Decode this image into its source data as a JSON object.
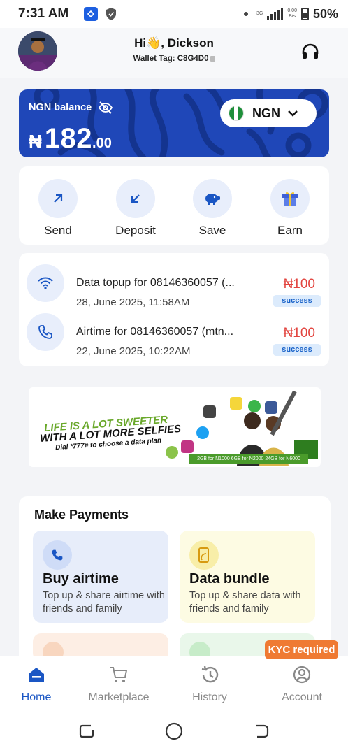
{
  "status_bar": {
    "time": "7:31 AM",
    "network_label": "3G",
    "speed": "0.00\nB/s",
    "battery": "50%"
  },
  "header": {
    "greeting": "Hi👋, Dickson",
    "wallet_tag": "Wallet Tag: C8G4D0"
  },
  "balance": {
    "label": "NGN balance",
    "currency_symbol": "₦",
    "amount_main": "182",
    "amount_decimal": ".00",
    "currency_selector": "NGN"
  },
  "actions": [
    {
      "label": "Send"
    },
    {
      "label": "Deposit"
    },
    {
      "label": "Save"
    },
    {
      "label": "Earn"
    }
  ],
  "transactions": [
    {
      "title": "Data topup for 08146360057 (...",
      "date": "28, June 2025, 11:58AM",
      "amount": "₦100",
      "status": "success"
    },
    {
      "title": "Airtime for 08146360057 (mtn...",
      "date": "22, June 2025, 10:22AM",
      "amount": "₦100",
      "status": "success"
    }
  ],
  "banner": {
    "line1": "LIFE IS A LOT SWEETER",
    "line2": "WITH A LOT MORE SELFIES",
    "line3": "Dial *777# to choose a data plan",
    "strip": "2GB for N1000   6GB for N2000   24GB for N6000"
  },
  "payments": {
    "title": "Make Payments",
    "cards": [
      {
        "title": "Buy airtime",
        "desc": "Top up & share airtime with friends and family"
      },
      {
        "title": "Data bundle",
        "desc": "Top up & share data with friends and family"
      }
    ]
  },
  "bottom_nav": {
    "items": [
      {
        "label": "Home"
      },
      {
        "label": "Marketplace"
      },
      {
        "label": "History"
      },
      {
        "label": "Account"
      }
    ],
    "kyc_badge": "KYC required"
  },
  "colors": {
    "brand_blue": "#1f47b8",
    "accent_blue": "#1a56c4",
    "debit_red": "#e2443f",
    "kyc_orange": "#ef7a33"
  }
}
